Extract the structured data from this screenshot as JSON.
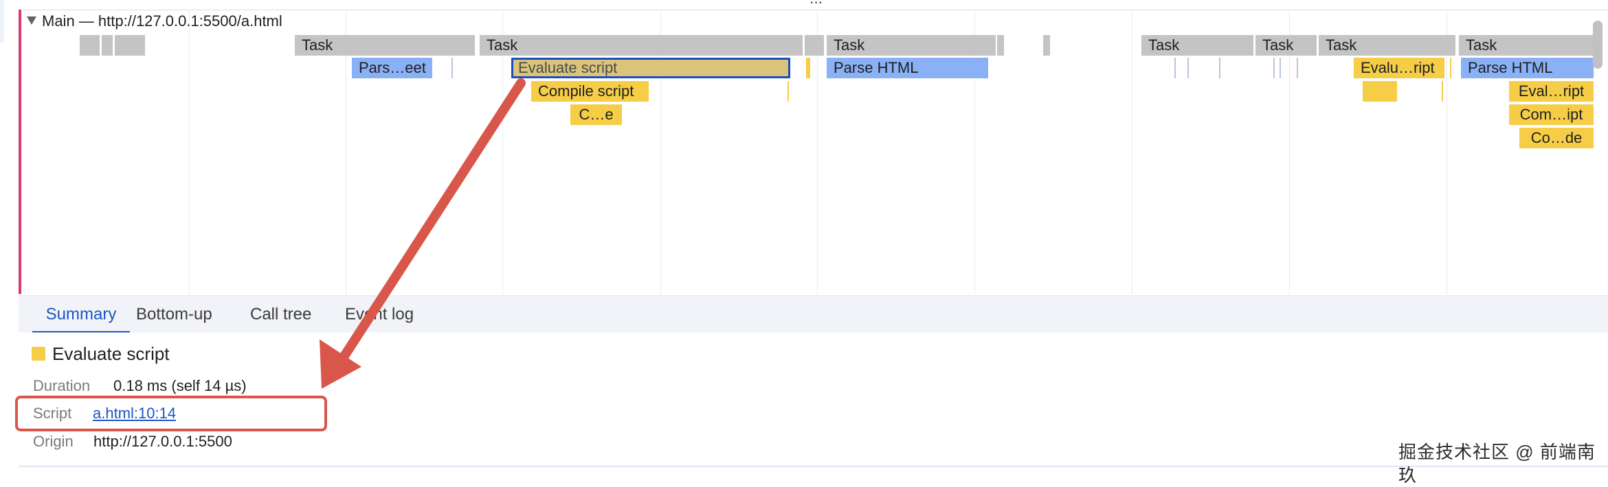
{
  "timeline": {
    "track_title": "Main — http://127.0.0.1:5500/a.html",
    "row1": [
      "Task",
      "Task",
      "Task",
      "Task",
      "Task",
      "Task",
      "Task"
    ],
    "row2": [
      "Pars…eet",
      "Evaluate script",
      "Parse HTML",
      "Evalu…ript",
      "Parse HTML"
    ],
    "row3": [
      "Compile script",
      "Eval…ript"
    ],
    "row4": [
      "C…e",
      "Com…ipt"
    ],
    "row5": [
      "Co…de"
    ]
  },
  "tabs": [
    "Summary",
    "Bottom-up",
    "Call tree",
    "Event log"
  ],
  "summary": {
    "title": "Evaluate script",
    "duration_label": "Duration",
    "duration_value": "0.18 ms (self 14 µs)",
    "script_label": "Script",
    "script_value": "a.html:10:14",
    "origin_label": "Origin",
    "origin_value": "http://127.0.0.1:5500"
  },
  "watermark": "掘金技术社区 @ 前端南玖",
  "colors": {
    "task": "#c4c4c4",
    "parse_html": "#8ab0f5",
    "script": "#f5cd47",
    "selection": "#1a4fc0",
    "annotation_red": "#d9574a",
    "track_marker": "#d63b6b",
    "link": "#1a56c4"
  }
}
